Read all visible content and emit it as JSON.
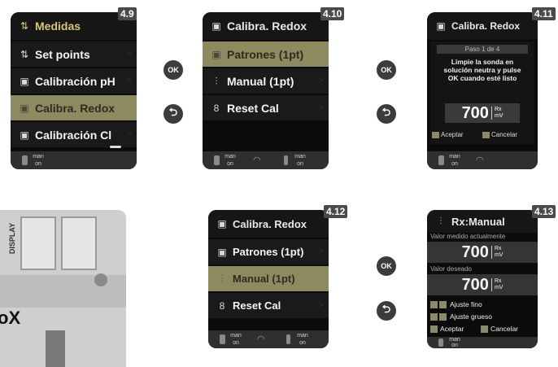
{
  "tags": {
    "s49": "4.9",
    "s410": "4.10",
    "s411": "4.11",
    "s412": "4.12",
    "s413": "4.13"
  },
  "nav": {
    "ok": "OK",
    "back": "⮌"
  },
  "s49": {
    "header": "Medidas",
    "items": [
      "Set points",
      "Calibración pH",
      "Calibra. Redox",
      "Calibración Cl"
    ],
    "status": {
      "man": "man",
      "on": "on"
    }
  },
  "s410": {
    "header": "Calibra. Redox",
    "items": [
      "Patrones (1pt)",
      "Manual (1pt)",
      "Reset Cal"
    ],
    "status": {
      "man1": "man",
      "on1": "on",
      "man2": "man",
      "on2": "on"
    }
  },
  "s411": {
    "header": "Calibra. Redox",
    "step": "Paso 1 de 4",
    "instruction": "Limpie la sonda en solución neutra y pulse OK cuando esté listo",
    "value": "700",
    "unit_top": "Rx",
    "unit_bot": "mV",
    "accept": "Aceptar",
    "cancel": "Cancelar",
    "status": {
      "man": "man",
      "on": "on"
    }
  },
  "s412": {
    "header": "Calibra. Redox",
    "items": [
      "Patrones (1pt)",
      "Manual (1pt)",
      "Reset Cal"
    ],
    "status": {
      "man1": "man",
      "on1": "on",
      "man2": "man",
      "on2": "on"
    }
  },
  "s413": {
    "header": "Rx:Manual",
    "measured_label": "Valor medido actualmente",
    "measured_value": "700",
    "desired_label": "Valor deseado",
    "desired_value": "700",
    "unit_top": "Rx",
    "unit_bot": "mV",
    "fine": "Ajuste fino",
    "coarse": "Ajuste grueso",
    "accept": "Aceptar",
    "cancel": "Cancelar",
    "status": {
      "man": "man",
      "on": "on"
    }
  },
  "photo_label": "DISPLAY",
  "photo_text": "oX"
}
